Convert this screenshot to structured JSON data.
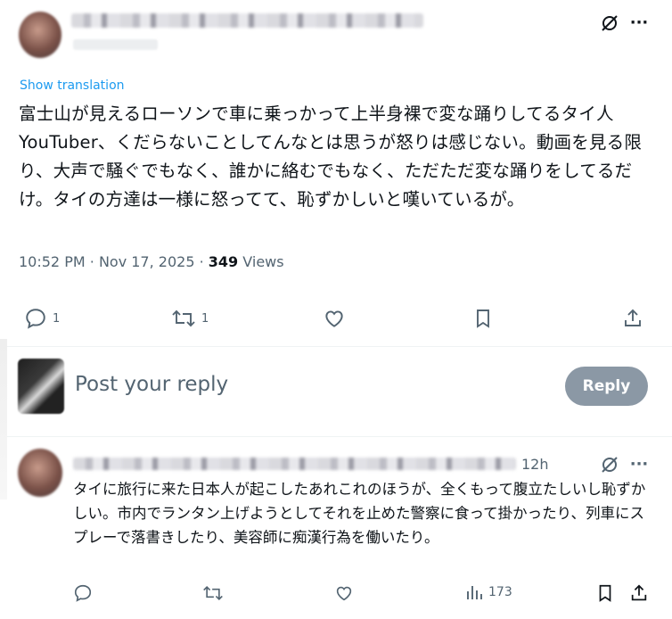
{
  "post": {
    "show_translation": "Show translation",
    "text": "富士山が見えるローソンで車に乗っかって上半身裸で変な踊りしてるタイ人YouTuber、くだらないことしてんなとは思うが怒りは感じない。動画を見る限り、大声で騒ぐでもなく、誰かに絡むでもなく、ただただ変な踊りをしてるだけ。タイの方達は一様に怒ってて、恥ずかしいと嘆いているが。",
    "time": "10:52 PM",
    "date": "Nov 17, 2025",
    "sep": "·",
    "views_count": "349",
    "views_label": "Views",
    "replies": "1",
    "reposts": "1",
    "more_glyph": "···"
  },
  "reply_box": {
    "placeholder": "Post your reply",
    "button": "Reply"
  },
  "comment": {
    "time": "12h",
    "text": "タイに旅行に来た日本人が起こしたあれこれのほうが、全くもって腹立たしいし恥ずかしい。市内でランタン上げようとしてそれを止めた警察に食って掛かったり、列車にスプレーで落書きしたり、美容師に痴漢行為を働いたり。",
    "views": "173",
    "more_glyph": "···"
  },
  "icons": [
    "grok-icon",
    "more-icon",
    "reply-icon",
    "repost-icon",
    "like-icon",
    "bookmark-icon",
    "share-icon",
    "views-icon"
  ],
  "colors": {
    "accent": "#1d9bf0",
    "muted": "#536471",
    "button": "#8b98a5"
  }
}
